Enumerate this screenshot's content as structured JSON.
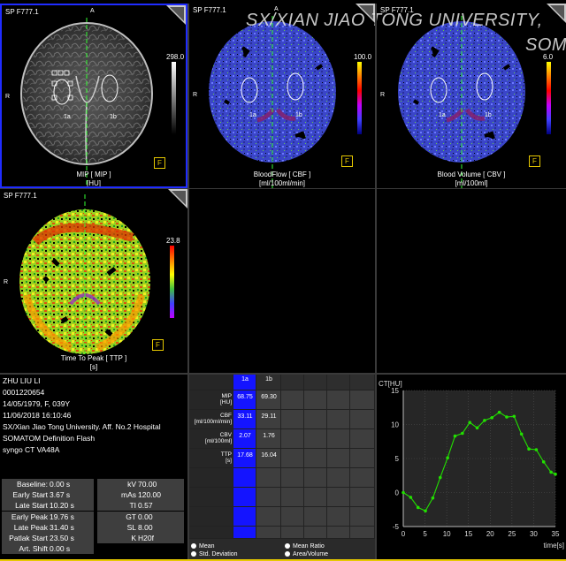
{
  "viewports": {
    "mip": {
      "series": "SP F777.1",
      "title": "MIP [ MIP ]",
      "unit": "[HU]",
      "scale_max": "298.0",
      "roi_a": "1a",
      "roi_b": "1b",
      "f": "F"
    },
    "cbf": {
      "series": "SP F777.1",
      "title": "BloodFlow [ CBF ]",
      "unit": "[ml/100ml/min]",
      "scale_max": "100.0",
      "roi_a": "1a",
      "roi_b": "1b",
      "f": "F"
    },
    "cbv": {
      "series": "SP F777.1",
      "title": "Blood Volume [ CBV ]",
      "unit": "[ml/100ml]",
      "scale_max": "6.0",
      "roi_a": "1a",
      "roi_b": "1b",
      "f": "F"
    },
    "ttp": {
      "series": "SP F777.1",
      "title": "Time To Peak [ TTP ]",
      "unit": "[s]",
      "scale_max": "23.8",
      "f": "F"
    }
  },
  "orientation": {
    "anterior": "A",
    "right": "R"
  },
  "watermark": {
    "line1": "SX/XIAN JIAO TONG UNIVERSITY,",
    "line2": "SOM"
  },
  "patient": {
    "name": "ZHU LIU LI",
    "id": "0001220654",
    "dob": "14/05/1979, F, 039Y",
    "date": "11/06/2018 16:10:46",
    "hospital": "SX/Xian Jiao Tong University. Aff. No.2 Hospital",
    "device": "SOMATOM Definition Flash",
    "software": "syngo CT VA48A"
  },
  "params_left": [
    {
      "label": "Baseline:",
      "value": "0.00 s"
    },
    {
      "label": "Early Start",
      "value": "3.67 s"
    },
    {
      "label": "Late Start",
      "value": "10.20 s"
    },
    {
      "label": "Early Peak",
      "value": "19.76 s"
    },
    {
      "label": "Late Peak",
      "value": "31.40 s"
    },
    {
      "label": "Patlak Start",
      "value": "23.50 s"
    },
    {
      "label": "Art. Shift",
      "value": "0.00 s"
    }
  ],
  "params_right": [
    {
      "label": "kV",
      "value": "70.00"
    },
    {
      "label": "mAs",
      "value": "120.00"
    },
    {
      "label": "TI",
      "value": "0.57"
    },
    {
      "label": "GT",
      "value": "0.00"
    },
    {
      "label": "SL",
      "value": "8.00"
    },
    {
      "label": "K",
      "value": "H20f"
    }
  ],
  "roi_table": {
    "columns": [
      "1a",
      "1b"
    ],
    "rows": [
      {
        "label": "MIP",
        "unit": "[HU]",
        "values": [
          "68.75",
          "69.30"
        ]
      },
      {
        "label": "CBF",
        "unit": "[ml/100ml/min]",
        "values": [
          "33.11",
          "29.11"
        ]
      },
      {
        "label": "CBV",
        "unit": "[ml/100ml]",
        "values": [
          "2.07",
          "1.76"
        ]
      },
      {
        "label": "TTP",
        "unit": "[s]",
        "values": [
          "17.68",
          "16.04"
        ]
      }
    ],
    "legend": {
      "mean": "Mean",
      "std": "Std. Deviation",
      "mean_ratio": "Mean Ratio",
      "area_volume": "Area/Volume"
    }
  },
  "colors": {
    "accent_blue": "#1f2cff",
    "roi_col": "#1414ff",
    "green_curve": "#22e000",
    "yellow_frame": "#e6c800"
  },
  "chart_data": {
    "type": "line",
    "ylabel": "CT[HU]",
    "xlabel": "time[s]",
    "xlim": [
      0,
      35
    ],
    "ylim": [
      -5,
      15
    ],
    "x_ticks": [
      0,
      5,
      10,
      15,
      20,
      25,
      30,
      35
    ],
    "y_ticks": [
      -5,
      0,
      5,
      10,
      15
    ],
    "x": [
      0,
      1.7,
      3.4,
      5.1,
      6.8,
      8.5,
      10.2,
      11.9,
      13.6,
      15.3,
      17.0,
      18.7,
      20.4,
      22.1,
      23.8,
      25.5,
      27.2,
      28.9,
      30.6,
      32.3,
      34.0,
      35.0
    ],
    "values": [
      0.0,
      -0.7,
      -2.2,
      -2.7,
      -0.8,
      2.2,
      5.1,
      8.3,
      8.7,
      10.3,
      9.5,
      10.6,
      11.0,
      11.8,
      11.1,
      11.2,
      8.6,
      6.4,
      6.3,
      4.5,
      3.0,
      2.7
    ]
  }
}
